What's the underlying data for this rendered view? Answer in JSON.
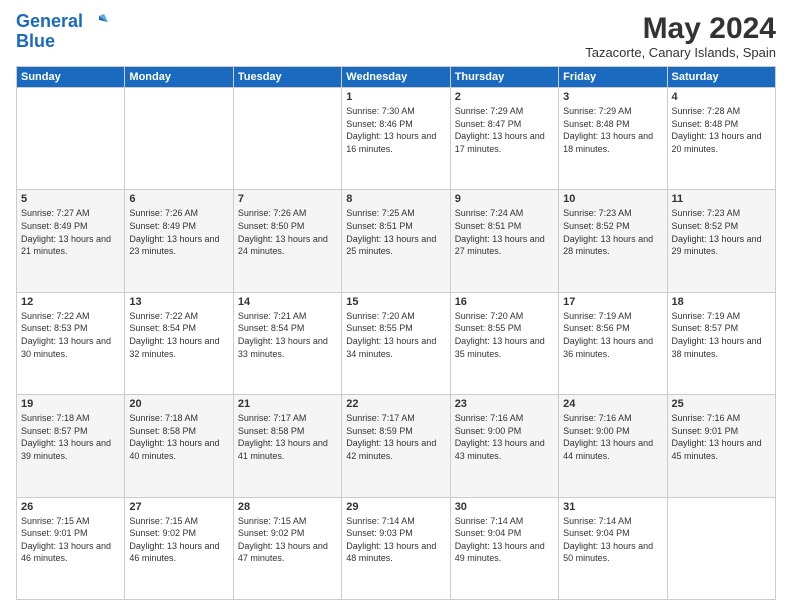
{
  "header": {
    "logo_line1": "General",
    "logo_line2": "Blue",
    "month_title": "May 2024",
    "location": "Tazacorte, Canary Islands, Spain"
  },
  "days_of_week": [
    "Sunday",
    "Monday",
    "Tuesday",
    "Wednesday",
    "Thursday",
    "Friday",
    "Saturday"
  ],
  "weeks": [
    [
      {
        "day": "",
        "info": ""
      },
      {
        "day": "",
        "info": ""
      },
      {
        "day": "",
        "info": ""
      },
      {
        "day": "1",
        "info": "Sunrise: 7:30 AM\nSunset: 8:46 PM\nDaylight: 13 hours and 16 minutes."
      },
      {
        "day": "2",
        "info": "Sunrise: 7:29 AM\nSunset: 8:47 PM\nDaylight: 13 hours and 17 minutes."
      },
      {
        "day": "3",
        "info": "Sunrise: 7:29 AM\nSunset: 8:48 PM\nDaylight: 13 hours and 18 minutes."
      },
      {
        "day": "4",
        "info": "Sunrise: 7:28 AM\nSunset: 8:48 PM\nDaylight: 13 hours and 20 minutes."
      }
    ],
    [
      {
        "day": "5",
        "info": "Sunrise: 7:27 AM\nSunset: 8:49 PM\nDaylight: 13 hours and 21 minutes."
      },
      {
        "day": "6",
        "info": "Sunrise: 7:26 AM\nSunset: 8:49 PM\nDaylight: 13 hours and 23 minutes."
      },
      {
        "day": "7",
        "info": "Sunrise: 7:26 AM\nSunset: 8:50 PM\nDaylight: 13 hours and 24 minutes."
      },
      {
        "day": "8",
        "info": "Sunrise: 7:25 AM\nSunset: 8:51 PM\nDaylight: 13 hours and 25 minutes."
      },
      {
        "day": "9",
        "info": "Sunrise: 7:24 AM\nSunset: 8:51 PM\nDaylight: 13 hours and 27 minutes."
      },
      {
        "day": "10",
        "info": "Sunrise: 7:23 AM\nSunset: 8:52 PM\nDaylight: 13 hours and 28 minutes."
      },
      {
        "day": "11",
        "info": "Sunrise: 7:23 AM\nSunset: 8:52 PM\nDaylight: 13 hours and 29 minutes."
      }
    ],
    [
      {
        "day": "12",
        "info": "Sunrise: 7:22 AM\nSunset: 8:53 PM\nDaylight: 13 hours and 30 minutes."
      },
      {
        "day": "13",
        "info": "Sunrise: 7:22 AM\nSunset: 8:54 PM\nDaylight: 13 hours and 32 minutes."
      },
      {
        "day": "14",
        "info": "Sunrise: 7:21 AM\nSunset: 8:54 PM\nDaylight: 13 hours and 33 minutes."
      },
      {
        "day": "15",
        "info": "Sunrise: 7:20 AM\nSunset: 8:55 PM\nDaylight: 13 hours and 34 minutes."
      },
      {
        "day": "16",
        "info": "Sunrise: 7:20 AM\nSunset: 8:55 PM\nDaylight: 13 hours and 35 minutes."
      },
      {
        "day": "17",
        "info": "Sunrise: 7:19 AM\nSunset: 8:56 PM\nDaylight: 13 hours and 36 minutes."
      },
      {
        "day": "18",
        "info": "Sunrise: 7:19 AM\nSunset: 8:57 PM\nDaylight: 13 hours and 38 minutes."
      }
    ],
    [
      {
        "day": "19",
        "info": "Sunrise: 7:18 AM\nSunset: 8:57 PM\nDaylight: 13 hours and 39 minutes."
      },
      {
        "day": "20",
        "info": "Sunrise: 7:18 AM\nSunset: 8:58 PM\nDaylight: 13 hours and 40 minutes."
      },
      {
        "day": "21",
        "info": "Sunrise: 7:17 AM\nSunset: 8:58 PM\nDaylight: 13 hours and 41 minutes."
      },
      {
        "day": "22",
        "info": "Sunrise: 7:17 AM\nSunset: 8:59 PM\nDaylight: 13 hours and 42 minutes."
      },
      {
        "day": "23",
        "info": "Sunrise: 7:16 AM\nSunset: 9:00 PM\nDaylight: 13 hours and 43 minutes."
      },
      {
        "day": "24",
        "info": "Sunrise: 7:16 AM\nSunset: 9:00 PM\nDaylight: 13 hours and 44 minutes."
      },
      {
        "day": "25",
        "info": "Sunrise: 7:16 AM\nSunset: 9:01 PM\nDaylight: 13 hours and 45 minutes."
      }
    ],
    [
      {
        "day": "26",
        "info": "Sunrise: 7:15 AM\nSunset: 9:01 PM\nDaylight: 13 hours and 46 minutes."
      },
      {
        "day": "27",
        "info": "Sunrise: 7:15 AM\nSunset: 9:02 PM\nDaylight: 13 hours and 46 minutes."
      },
      {
        "day": "28",
        "info": "Sunrise: 7:15 AM\nSunset: 9:02 PM\nDaylight: 13 hours and 47 minutes."
      },
      {
        "day": "29",
        "info": "Sunrise: 7:14 AM\nSunset: 9:03 PM\nDaylight: 13 hours and 48 minutes."
      },
      {
        "day": "30",
        "info": "Sunrise: 7:14 AM\nSunset: 9:04 PM\nDaylight: 13 hours and 49 minutes."
      },
      {
        "day": "31",
        "info": "Sunrise: 7:14 AM\nSunset: 9:04 PM\nDaylight: 13 hours and 50 minutes."
      },
      {
        "day": "",
        "info": ""
      }
    ]
  ]
}
